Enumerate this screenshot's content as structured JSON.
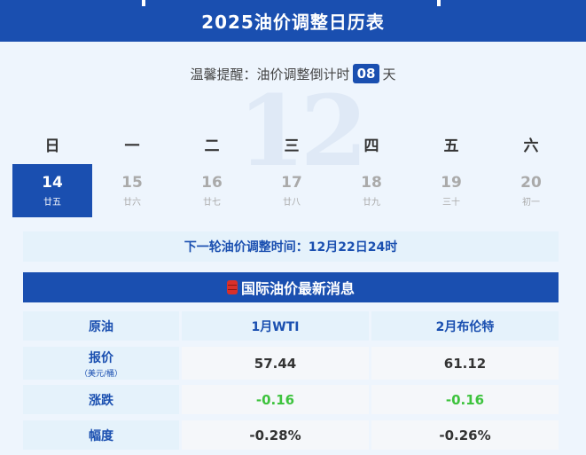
{
  "header": {
    "title": "2025油价调整日历表"
  },
  "reminder": {
    "prefix": "温馨提醒：油价调整倒计时",
    "days": "08",
    "suffix": "天"
  },
  "calendar": {
    "month_watermark": "12",
    "weekdays": [
      "日",
      "一",
      "二",
      "三",
      "四",
      "五",
      "六"
    ],
    "days": [
      {
        "num": "14",
        "lunar": "廿五",
        "selected": true
      },
      {
        "num": "15",
        "lunar": "廿六",
        "selected": false
      },
      {
        "num": "16",
        "lunar": "廿七",
        "selected": false
      },
      {
        "num": "17",
        "lunar": "廿八",
        "selected": false
      },
      {
        "num": "18",
        "lunar": "廿九",
        "selected": false
      },
      {
        "num": "19",
        "lunar": "三十",
        "selected": false
      },
      {
        "num": "20",
        "lunar": "初一",
        "selected": false
      }
    ]
  },
  "next_adjustment": "下一轮油价调整时间：12月22日24时",
  "news": {
    "title": "国际油价最新消息",
    "icon": "oil-barrel-icon",
    "table": {
      "headers": [
        "原油",
        "1月WTI",
        "2月布伦特"
      ],
      "price_label": "报价",
      "price_unit": "（美元/桶）",
      "prices": [
        "57.44",
        "61.12"
      ],
      "change_label": "涨跌",
      "changes": [
        "-0.16",
        "-0.16"
      ],
      "pct_label": "幅度",
      "pcts": [
        "-0.28%",
        "-0.26%"
      ]
    }
  },
  "colors": {
    "primary": "#1a4fb0",
    "light": "#e5f2fb",
    "change": "#3ec33e"
  }
}
